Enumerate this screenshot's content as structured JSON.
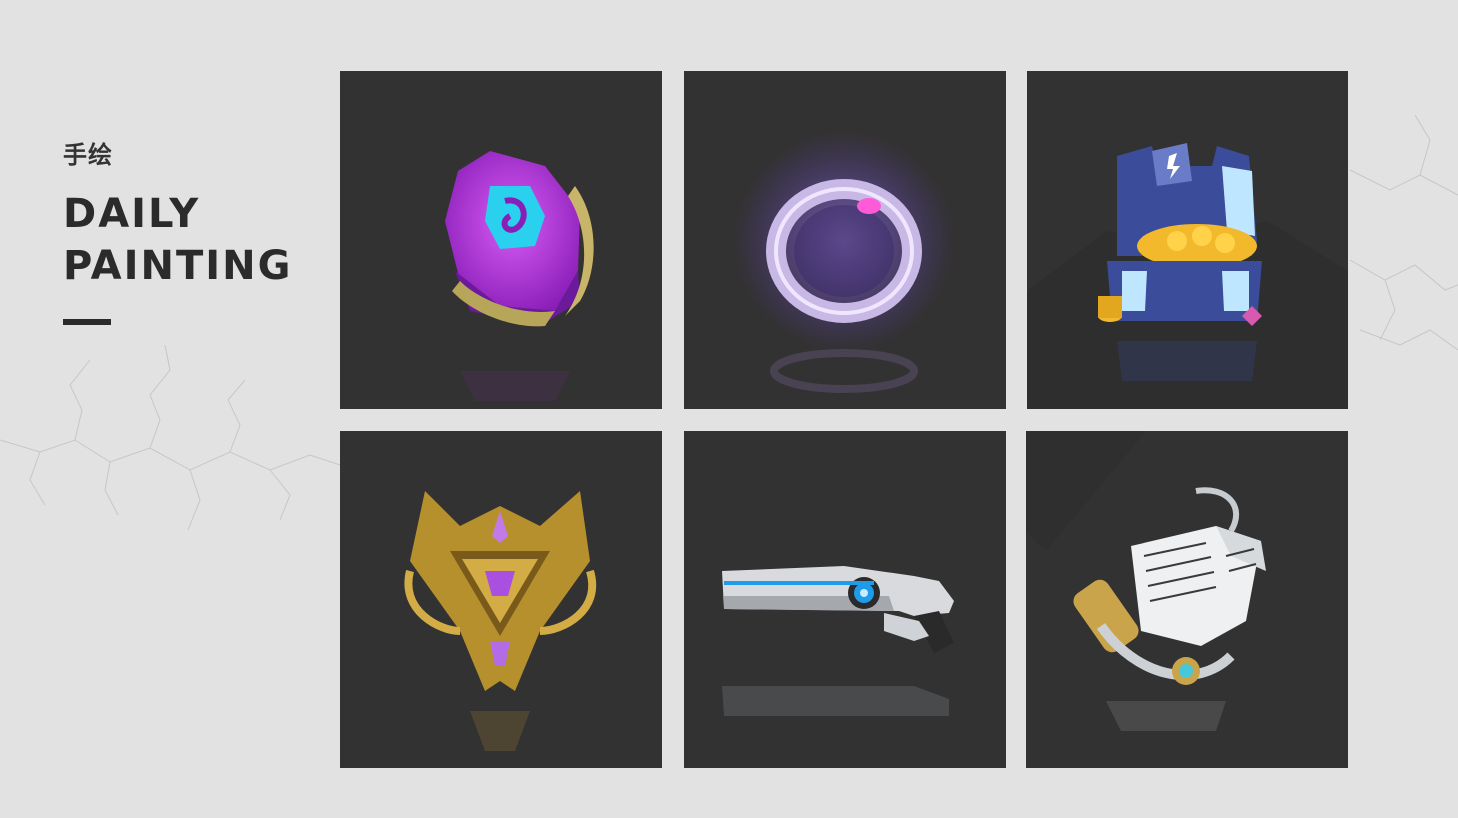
{
  "page": {
    "subtitle": "手绘",
    "title_line1": "DAILY",
    "title_line2": "PAINTING",
    "background_color": "#e2e2e2",
    "tile_color": "#333232",
    "accent_dash_color": "#2b2b2b"
  },
  "gallery": {
    "items": [
      {
        "name": "rune-stone-icon"
      },
      {
        "name": "glowing-ring-icon"
      },
      {
        "name": "treasure-chest-icon"
      },
      {
        "name": "rank-badge-icon"
      },
      {
        "name": "scifi-gun-icon"
      },
      {
        "name": "magic-scroll-icon"
      }
    ]
  }
}
